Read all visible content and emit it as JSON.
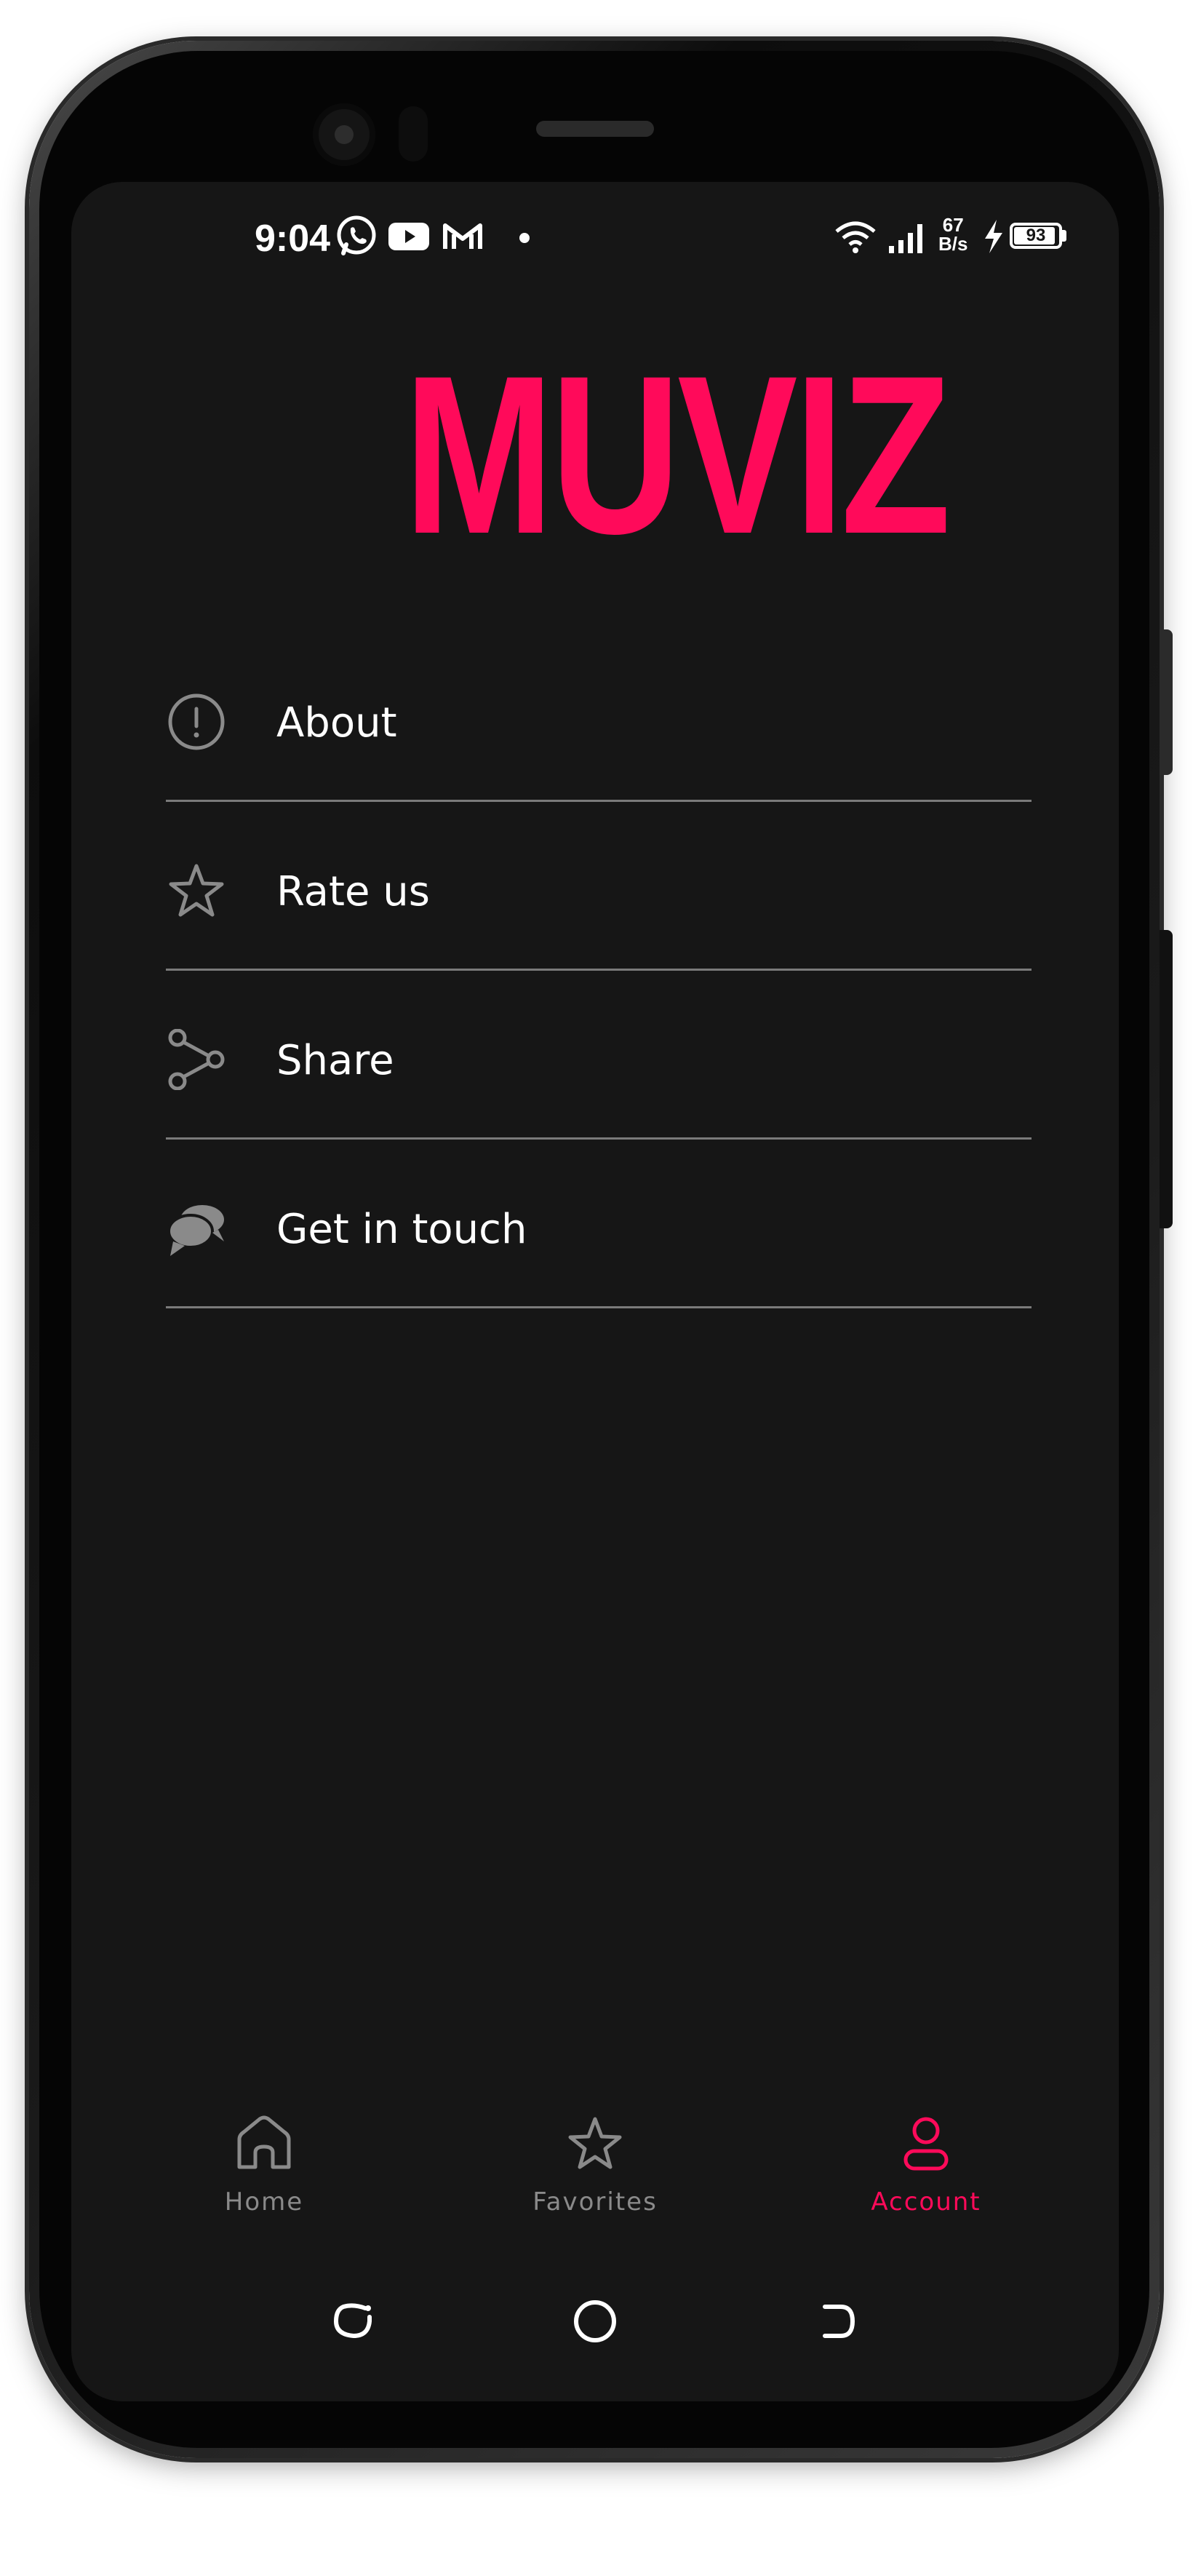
{
  "status_bar": {
    "time": "9:04",
    "net_speed_value": "67",
    "net_speed_unit": "B/s",
    "battery_percent": "93",
    "battery_level": 0.93,
    "notification_icons": [
      "whatsapp-icon",
      "youtube-icon",
      "gmail-icon",
      "dot-icon"
    ],
    "system_icons": [
      "wifi-icon",
      "signal-icon",
      "charging-icon",
      "battery-icon"
    ]
  },
  "app": {
    "logo_text": "MUVIZ",
    "accent_color": "#ff0a5a",
    "background_color": "#161616",
    "divider_color": "#7a7a7a",
    "inactive_color": "#8a8a8a"
  },
  "menu": {
    "items": [
      {
        "label": "About",
        "icon": "info-exclamation-icon"
      },
      {
        "label": "Rate us",
        "icon": "star-outline-icon"
      },
      {
        "label": "Share",
        "icon": "share-nodes-icon"
      },
      {
        "label": "Get in touch",
        "icon": "chat-bubbles-icon"
      }
    ]
  },
  "bottom_nav": {
    "items": [
      {
        "label": "Home",
        "icon": "home-icon",
        "active": false
      },
      {
        "label": "Favorites",
        "icon": "star-outline-icon",
        "active": false
      },
      {
        "label": "Account",
        "icon": "user-icon",
        "active": true
      }
    ]
  },
  "system_nav": {
    "buttons": [
      "recents-icon",
      "home-circle-icon",
      "back-icon"
    ]
  }
}
